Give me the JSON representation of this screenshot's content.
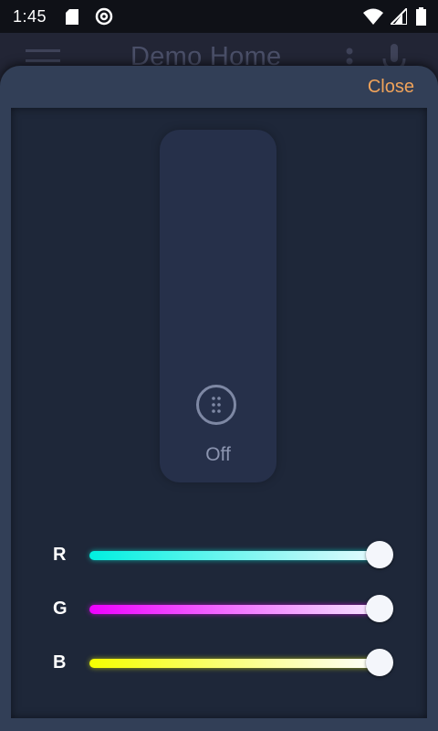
{
  "status_bar": {
    "time": "1:45",
    "icons": [
      "sd-card-icon",
      "at-sign-icon",
      "wifi-icon",
      "signal-icon",
      "battery-icon"
    ]
  },
  "app_bar": {
    "title": "Demo Home",
    "icons": [
      "menu-icon",
      "more-vert-icon",
      "microphone-icon"
    ]
  },
  "dialog": {
    "close_label": "Close",
    "close_color": "#f0a35a",
    "light": {
      "state_label": "Off",
      "icon": "light-switch-icon"
    },
    "rgb_sliders": [
      {
        "label": "R",
        "value": 1.0,
        "gradient_start": "#00f0e0"
      },
      {
        "label": "G",
        "value": 1.0,
        "gradient_start": "#ee00ff"
      },
      {
        "label": "B",
        "value": 1.0,
        "gradient_start": "#f5ff00"
      }
    ]
  }
}
